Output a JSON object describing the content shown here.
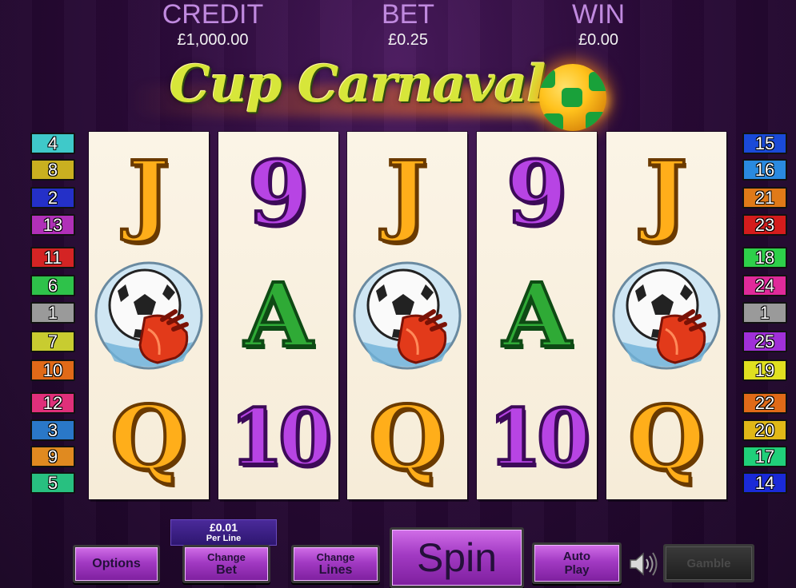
{
  "header": {
    "credit": {
      "label": "CREDIT",
      "value": "£1,000.00"
    },
    "bet": {
      "label": "BET",
      "value": "£0.25"
    },
    "win": {
      "label": "WIN",
      "value": "£0.00"
    }
  },
  "logo": {
    "text": "Cup Carnaval"
  },
  "reels": [
    {
      "symbols": [
        {
          "glyph": "J",
          "style": "gold"
        },
        {
          "glyph": "",
          "style": "ball-glove"
        },
        {
          "glyph": "Q",
          "style": "gold"
        }
      ]
    },
    {
      "symbols": [
        {
          "glyph": "9",
          "style": "purple"
        },
        {
          "glyph": "A",
          "style": "green"
        },
        {
          "glyph": "10",
          "style": "purple"
        }
      ]
    },
    {
      "symbols": [
        {
          "glyph": "J",
          "style": "gold"
        },
        {
          "glyph": "",
          "style": "ball-glove"
        },
        {
          "glyph": "Q",
          "style": "gold"
        }
      ]
    },
    {
      "symbols": [
        {
          "glyph": "9",
          "style": "purple"
        },
        {
          "glyph": "A",
          "style": "green"
        },
        {
          "glyph": "10",
          "style": "purple"
        }
      ]
    },
    {
      "symbols": [
        {
          "glyph": "J",
          "style": "gold"
        },
        {
          "glyph": "",
          "style": "ball-glove"
        },
        {
          "glyph": "Q",
          "style": "gold"
        }
      ]
    }
  ],
  "paylines": {
    "left": [
      {
        "num": "4",
        "color": "#3fc9c9"
      },
      {
        "num": "8",
        "color": "#c9b020"
      },
      {
        "num": "2",
        "color": "#2430c8"
      },
      {
        "num": "13",
        "color": "#b030b8"
      },
      {
        "num": "11",
        "color": "#d42424"
      },
      {
        "num": "6",
        "color": "#2ec24a"
      },
      {
        "num": "1",
        "color": "#9a9a9a"
      },
      {
        "num": "7",
        "color": "#c8cc30"
      },
      {
        "num": "10",
        "color": "#e06a18"
      },
      {
        "num": "12",
        "color": "#e0307a"
      },
      {
        "num": "3",
        "color": "#2a78c8"
      },
      {
        "num": "9",
        "color": "#e08a20"
      },
      {
        "num": "5",
        "color": "#28c080"
      }
    ],
    "right": [
      {
        "num": "15",
        "color": "#1a4ad8"
      },
      {
        "num": "16",
        "color": "#2a8ae0"
      },
      {
        "num": "21",
        "color": "#e07a18"
      },
      {
        "num": "23",
        "color": "#d41c1c"
      },
      {
        "num": "18",
        "color": "#2ed04a"
      },
      {
        "num": "24",
        "color": "#e02a9a"
      },
      {
        "num": "1",
        "color": "#9a9a9a"
      },
      {
        "num": "25",
        "color": "#a030d8"
      },
      {
        "num": "19",
        "color": "#e0e020"
      },
      {
        "num": "22",
        "color": "#e06a18"
      },
      {
        "num": "20",
        "color": "#e0b818"
      },
      {
        "num": "17",
        "color": "#20d07a"
      },
      {
        "num": "14",
        "color": "#1a2ad8"
      }
    ]
  },
  "per_line": {
    "amount": "£0.01",
    "label": "Per Line"
  },
  "buttons": {
    "options": "Options",
    "change_bet_top": "Change",
    "change_bet_bottom": "Bet",
    "change_lines_top": "Change",
    "change_lines_bottom": "Lines",
    "spin": "Spin",
    "auto_top": "Auto",
    "auto_bottom": "Play",
    "gamble": "Gamble"
  },
  "colors": {
    "accent": "#b34fd6",
    "label": "#c08adf"
  }
}
